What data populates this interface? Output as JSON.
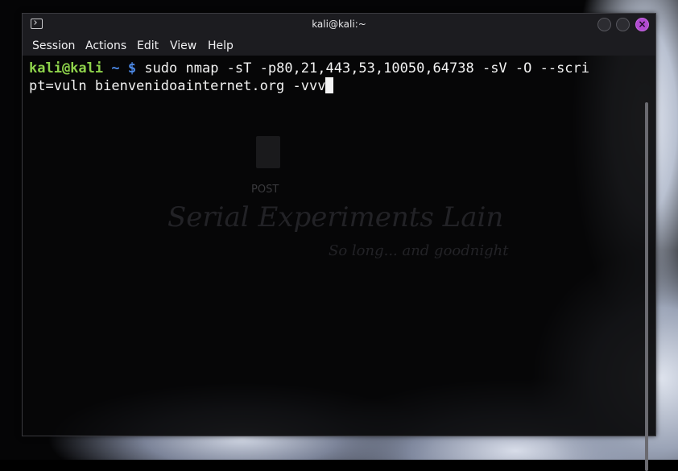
{
  "window": {
    "title": "kali@kali:~"
  },
  "menu": {
    "items": [
      "Session",
      "Actions",
      "Edit",
      "View",
      "Help"
    ]
  },
  "terminal": {
    "prompt_user": "kali@kali",
    "prompt_dir": " ~ ",
    "prompt_symbol": "$",
    "line1": " sudo nmap -sT -p80,21,443,53,10050,64738 -sV -O --scri",
    "line2": "pt=vuln bienvenidoainternet.org -vvv"
  },
  "desktop": {
    "file_label": "POST",
    "wallpaper_title": "Serial Experiments Lain",
    "wallpaper_subtitle": "So long... and goodnight"
  },
  "colors": {
    "prompt_user": "#8ed24b",
    "prompt_dir": "#4d8ae8",
    "close_button": "#b04ad0"
  }
}
